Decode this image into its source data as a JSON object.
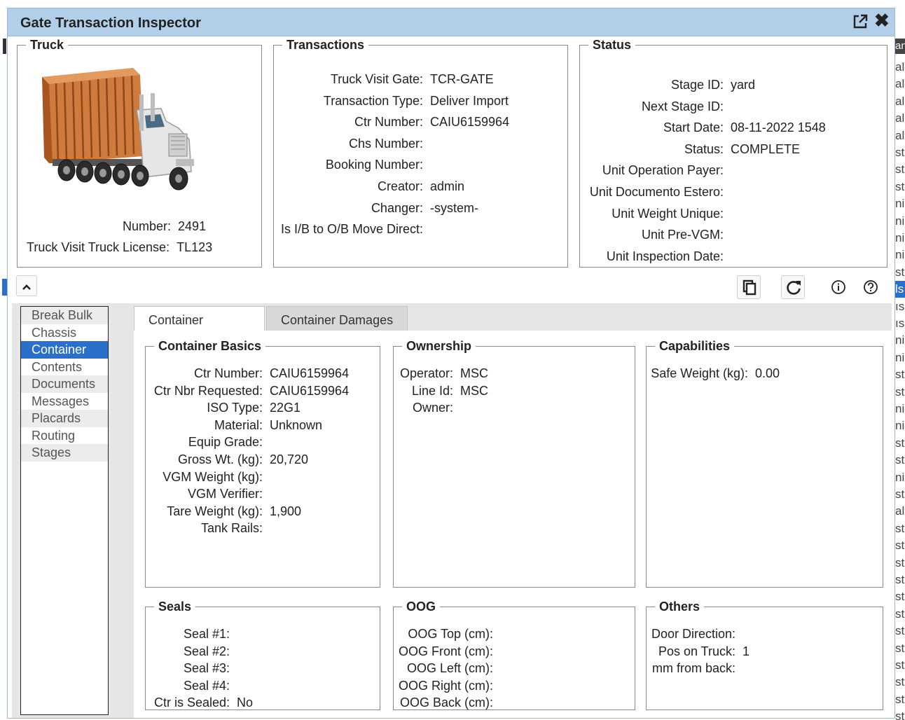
{
  "window": {
    "title": "Gate Transaction Inspector"
  },
  "truck": {
    "legend": "Truck",
    "number_label": "Number:",
    "number_value": "2491",
    "license_label": "Truck Visit Truck License:",
    "license_value": "TL123"
  },
  "transactions": {
    "legend": "Transactions",
    "rows": [
      {
        "label": "Truck Visit Gate:",
        "value": "TCR-GATE"
      },
      {
        "label": "Transaction Type:",
        "value": "Deliver Import"
      },
      {
        "label": "Ctr Number:",
        "value": "CAIU6159964"
      },
      {
        "label": "Chs Number:",
        "value": ""
      },
      {
        "label": "Booking Number:",
        "value": ""
      },
      {
        "label": "Creator:",
        "value": "admin"
      },
      {
        "label": "Changer:",
        "value": "-system-"
      },
      {
        "label": "Is I/B to O/B Move Direct:",
        "value": ""
      }
    ]
  },
  "status": {
    "legend": "Status",
    "rows": [
      {
        "label": "Stage ID:",
        "value": "yard"
      },
      {
        "label": "Next Stage ID:",
        "value": ""
      },
      {
        "label": "Start Date:",
        "value": "08-11-2022 1548"
      },
      {
        "label": "Status:",
        "value": "COMPLETE"
      },
      {
        "label": "Unit Operation Payer:",
        "value": ""
      },
      {
        "label": "Unit Documento Estero:",
        "value": ""
      },
      {
        "label": "Unit Weight Unique:",
        "value": ""
      },
      {
        "label": "Unit Pre-VGM:",
        "value": ""
      },
      {
        "label": "Unit Inspection Date:",
        "value": ""
      }
    ]
  },
  "nav": {
    "items": [
      "Break Bulk",
      "Chassis",
      "Container",
      "Contents",
      "Documents",
      "Messages",
      "Placards",
      "Routing",
      "Stages"
    ],
    "selected": "Container"
  },
  "tabs": [
    "Container",
    "Container Damages"
  ],
  "container_basics": {
    "legend": "Container Basics",
    "rows": [
      {
        "label": "Ctr Number:",
        "value": "CAIU6159964"
      },
      {
        "label": "Ctr Nbr Requested:",
        "value": "CAIU6159964"
      },
      {
        "label": "ISO Type:",
        "value": "22G1"
      },
      {
        "label": "Material:",
        "value": "Unknown"
      },
      {
        "label": "Equip Grade:",
        "value": ""
      },
      {
        "label": "Gross Wt. (kg):",
        "value": "20,720"
      },
      {
        "label": "VGM Weight (kg):",
        "value": ""
      },
      {
        "label": "VGM Verifier:",
        "value": ""
      },
      {
        "label": "Tare Weight (kg):",
        "value": "1,900"
      },
      {
        "label": "Tank Rails:",
        "value": ""
      }
    ]
  },
  "ownership": {
    "legend": "Ownership",
    "rows": [
      {
        "label": "Operator:",
        "value": "MSC"
      },
      {
        "label": "Line Id:",
        "value": "MSC"
      },
      {
        "label": "Owner:",
        "value": ""
      }
    ]
  },
  "capabilities": {
    "legend": "Capabilities",
    "rows": [
      {
        "label": "Safe Weight (kg):",
        "value": "0.00"
      }
    ]
  },
  "seals": {
    "legend": "Seals",
    "rows": [
      {
        "label": "Seal #1:",
        "value": ""
      },
      {
        "label": "Seal #2:",
        "value": ""
      },
      {
        "label": "Seal #3:",
        "value": ""
      },
      {
        "label": "Seal #4:",
        "value": ""
      },
      {
        "label": "Ctr is Sealed:",
        "value": "No"
      }
    ]
  },
  "oog": {
    "legend": "OOG",
    "rows": [
      {
        "label": "OOG Top (cm):",
        "value": ""
      },
      {
        "label": "OOG Front (cm):",
        "value": ""
      },
      {
        "label": "OOG Left (cm):",
        "value": ""
      },
      {
        "label": "OOG Right (cm):",
        "value": ""
      },
      {
        "label": "OOG Back (cm):",
        "value": ""
      }
    ]
  },
  "others": {
    "legend": "Others",
    "rows": [
      {
        "label": "Door Direction:",
        "value": ""
      },
      {
        "label": "Pos on Truck:",
        "value": "1"
      },
      {
        "label": "mm from back:",
        "value": ""
      }
    ]
  },
  "background": {
    "right_rows": [
      "al",
      "al",
      "al",
      "al",
      "al",
      "st",
      "st",
      "st",
      "ni",
      "ni",
      "ni",
      "ni",
      "st",
      "ls",
      "ıs",
      "ıs",
      "ni",
      "ni",
      "st",
      "st",
      "ni",
      "ni",
      "st",
      "st",
      "ni",
      "st",
      "al",
      "st",
      "st",
      "st",
      "st",
      "st",
      "st",
      "st",
      "st",
      "st",
      "st",
      "st",
      "st"
    ],
    "right_header": "an"
  },
  "colors": {
    "titlebar": "#b2cfe9",
    "selection": "#2a6fc9",
    "truck_container": "#c8682a"
  }
}
